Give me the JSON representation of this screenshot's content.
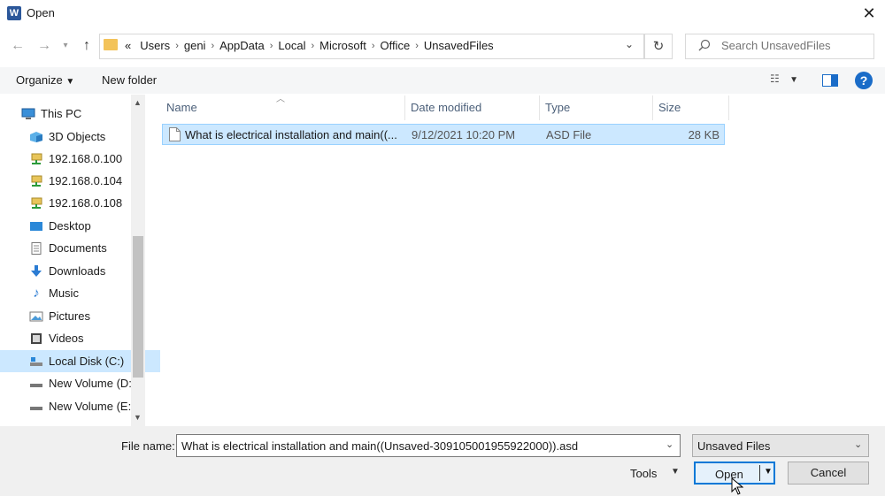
{
  "window": {
    "title": "Open",
    "app_icon": "W"
  },
  "address": {
    "prefix": "«",
    "crumbs": [
      "Users",
      "geni",
      "AppData",
      "Local",
      "Microsoft",
      "Office",
      "UnsavedFiles"
    ]
  },
  "search": {
    "placeholder": "Search UnsavedFiles"
  },
  "toolbar": {
    "organize_label": "Organize",
    "new_folder_label": "New folder",
    "help_label": "?"
  },
  "nav": {
    "items": [
      {
        "label": "This PC",
        "icon": "computer-icon"
      },
      {
        "label": "3D Objects",
        "icon": "cube-icon"
      },
      {
        "label": "192.168.0.100",
        "icon": "network-drive-icon"
      },
      {
        "label": "192.168.0.104",
        "icon": "network-drive-icon"
      },
      {
        "label": "192.168.0.108",
        "icon": "network-drive-icon"
      },
      {
        "label": "Desktop",
        "icon": "desktop-icon"
      },
      {
        "label": "Documents",
        "icon": "documents-icon"
      },
      {
        "label": "Downloads",
        "icon": "download-icon"
      },
      {
        "label": "Music",
        "icon": "music-icon"
      },
      {
        "label": "Pictures",
        "icon": "pictures-icon"
      },
      {
        "label": "Videos",
        "icon": "videos-icon"
      },
      {
        "label": "Local Disk (C:)",
        "icon": "disk-icon"
      },
      {
        "label": "New Volume (D:",
        "icon": "drive-icon"
      },
      {
        "label": "New Volume (E:)",
        "icon": "drive-icon"
      }
    ]
  },
  "columns": {
    "name": "Name",
    "date": "Date modified",
    "type": "Type",
    "size": "Size"
  },
  "files": [
    {
      "name": "What is electrical installation and main((...",
      "date": "9/12/2021 10:20 PM",
      "type": "ASD File",
      "size": "28 KB"
    }
  ],
  "bottom": {
    "file_name_label": "File name:",
    "file_name_value": "What is electrical installation and main((Unsaved-309105001955922000)).asd",
    "file_type_value": "Unsaved Files",
    "tools_label": "Tools",
    "open_label": "Open",
    "cancel_label": "Cancel"
  },
  "colors": {
    "selection": "#cce8ff",
    "accent": "#0078d7",
    "folder": "#f3c35a"
  }
}
